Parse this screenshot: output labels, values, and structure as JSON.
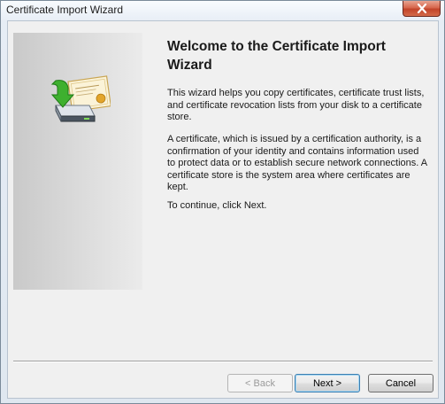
{
  "window": {
    "title": "Certificate Import Wizard",
    "close_icon": "close-icon"
  },
  "content": {
    "heading": "Welcome to the Certificate Import Wizard",
    "paragraph1": "This wizard helps you copy certificates, certificate trust lists, and certificate revocation lists from your disk to a certificate store.",
    "paragraph2": "A certificate, which is issued by a certification authority, is a confirmation of your identity and contains information used to protect data or to establish secure network connections. A certificate store is the system area where certificates are kept.",
    "paragraph3": "To continue, click Next.",
    "wizard_icon": "certificate-import-icon"
  },
  "buttons": {
    "back": "< Back",
    "next": "Next >",
    "cancel": "Cancel",
    "back_enabled": false
  }
}
